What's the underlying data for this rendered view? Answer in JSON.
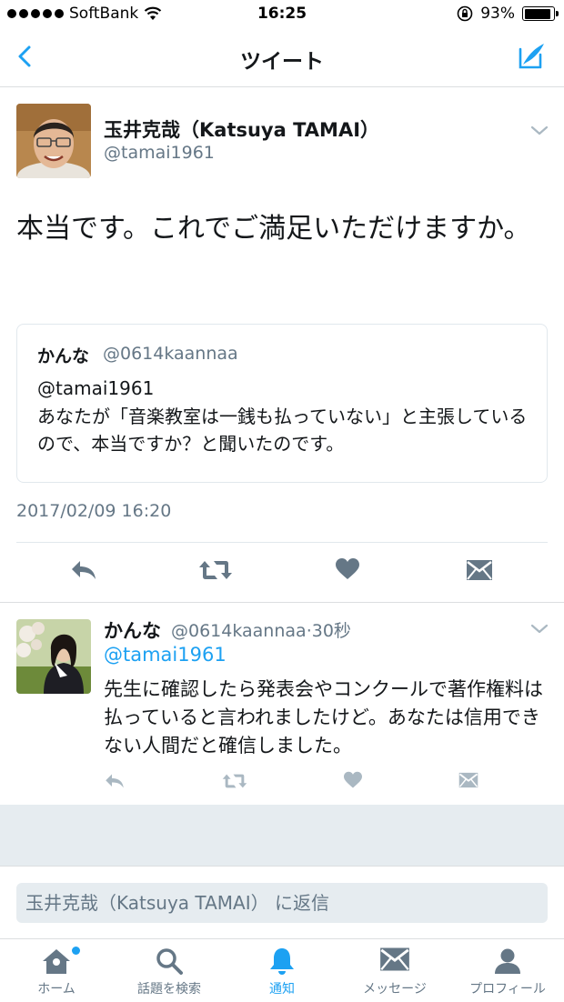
{
  "status_bar": {
    "carrier": "SoftBank",
    "time": "16:25",
    "battery": "93%",
    "battery_level": 0.93
  },
  "nav": {
    "title": "ツイート"
  },
  "main_tweet": {
    "author_name": "玉井克哉（Katsuya TAMAI）",
    "author_handle": "@tamai1961",
    "text": "本当です。これでご満足いただけますか。",
    "quote": {
      "name": "かんな",
      "handle": "@0614kaannaa",
      "mention": "@tamai1961",
      "text": "あなたが「音楽教室は一銭も払っていない」と主張しているので、本当ですか？と聞いたのです。"
    },
    "timestamp": "2017/02/09 16:20"
  },
  "reply_tweet": {
    "author_name": "かんな",
    "author_handle": "@0614kaannaa",
    "time_ago": "30秒",
    "mention": "@tamai1961",
    "text": "先生に確認したら発表会やコンクールで著作権料は払っていると言われましたけど。あなたは信用できない人間だと確信しました。"
  },
  "reply_box": {
    "placeholder": "玉井克哉（Katsuya TAMAI） に返信"
  },
  "tab_bar": {
    "tabs": [
      {
        "label": "ホーム",
        "icon": "home-icon"
      },
      {
        "label": "話題を検索",
        "icon": "search-icon"
      },
      {
        "label": "通知",
        "icon": "bell-icon"
      },
      {
        "label": "メッセージ",
        "icon": "envelope-icon"
      },
      {
        "label": "プロフィール",
        "icon": "profile-icon"
      }
    ],
    "active_index": 2
  },
  "colors": {
    "accent": "#1da1f2",
    "muted": "#657786",
    "action_gray": "#657786",
    "divider": "#dcdee0",
    "background_gray": "#e6ecf0"
  }
}
